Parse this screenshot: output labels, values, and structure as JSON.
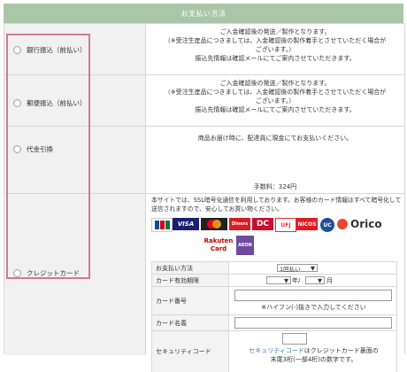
{
  "header": {
    "title": "お支払い方法"
  },
  "methods": [
    {
      "label": "銀行振込（前払い）",
      "lines": [
        "ご入金確認後の発送／製作となります。",
        "（※受注生産品につきましては、入金確認後の製作着手とさせていただく場合が",
        "ございます。）",
        "振込先情報は確認メールにてご案内させていただきます。"
      ]
    },
    {
      "label": "郵便振込（前払い）",
      "lines": [
        "ご入金確認後の発送／製作となります。",
        "（※受注生産品につきましては、入金確認後の製作着手とさせていただく場合が",
        "ございます。）",
        "振込先情報は確認メールにてご案内させていただきます。"
      ]
    },
    {
      "label": "代金引換",
      "lines": [
        "商品お届け時に、配達員に現金にてお支払いください。",
        "手数料：324円"
      ]
    },
    {
      "label": "クレジットカード",
      "intro": "本サイトでは、SSL暗号化通信を利用しております。お客様のカード情報はすべて暗号化して送信されますので、安心してお買い物ください。"
    }
  ],
  "card_logos": {
    "jcb": "JCB",
    "visa": "VISA",
    "diners": "Diners",
    "dc": "DC",
    "uc": "UFJ",
    "nicos": "NICOS",
    "ucblue": "UC",
    "orico": "Orico",
    "rakuten_1": "Rakuten",
    "rakuten_2": "Card",
    "aeon": "AEON"
  },
  "form": {
    "payment_label": "お支払い方法",
    "payment_value": "1回払い",
    "expiry_label": "カード有効期限",
    "year_unit": "年/",
    "month_unit": "月",
    "number_label": "カード番号",
    "number_note": "※ハイフン(-)抜きで入力してください",
    "name_label": "カード名義",
    "cvv_label": "セキュリティコード",
    "cvv_note_link": "セキュリティコード",
    "cvv_note_1": "はクレジットカード裏面の",
    "cvv_note_2": "末尾3桁(一部4桁)の数字です。"
  }
}
